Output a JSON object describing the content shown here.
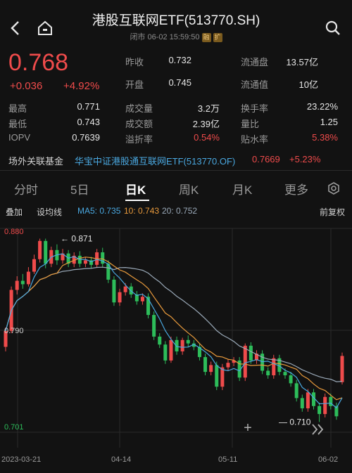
{
  "header": {
    "title": "港股互联网ETF(513770.SH)",
    "status": "闭市 06-02 15:59:50",
    "badge1": "融",
    "badge2": "扩"
  },
  "quote": {
    "price": "0.768",
    "change": "+0.036",
    "change_pct": "+4.92%",
    "rows": [
      [
        {
          "l": "昨收",
          "v": "0.732"
        },
        {
          "l": "流通盘",
          "v": "13.57亿"
        }
      ],
      [
        {
          "l": "开盘",
          "v": "0.745"
        },
        {
          "l": "流通值",
          "v": "10亿"
        }
      ],
      [
        {
          "l": "最高",
          "v": "0.771"
        },
        {
          "l": "成交量",
          "v": "3.2万"
        },
        {
          "l": "换手率",
          "v": "23.22%"
        }
      ],
      [
        {
          "l": "最低",
          "v": "0.743"
        },
        {
          "l": "成交额",
          "v": "2.39亿"
        },
        {
          "l": "量比",
          "v": "1.25"
        }
      ],
      [
        {
          "l": "IOPV",
          "v": "0.7639"
        },
        {
          "l": "溢折率",
          "v": "0.54%"
        },
        {
          "l": "贴水率",
          "v": "5.38%"
        }
      ]
    ]
  },
  "fund": {
    "label": "场外关联基金",
    "name": "华宝中证港股通互联网ETF(513770.OF)",
    "value": "0.7669",
    "change": "+5.23%"
  },
  "tabs": [
    "分时",
    "5日",
    "日K",
    "周K",
    "月K",
    "更多"
  ],
  "active_tab": "日K",
  "indicators": {
    "overlay": "叠加",
    "trend": "设均线",
    "ma5": "MA5: 0.735",
    "ma10": "10: 0.743",
    "ma20": "20: 0.752",
    "adjust": "前复权"
  },
  "colors": {
    "up": "#ef4b4b",
    "down": "#2dbd5a",
    "ma5": "#4aa8e0",
    "ma10": "#e89a3c",
    "ma20": "#9aa9b8"
  },
  "chart_data": {
    "type": "candlestick",
    "y_labels": [
      "0.880",
      "0.790",
      "0.701"
    ],
    "ylim": [
      0.701,
      0.88
    ],
    "x_labels": [
      "2023-03-21",
      "04-14",
      "05-11",
      "06-02"
    ],
    "annotations": {
      "high": "0.871",
      "low": "0.710"
    },
    "candles": [
      [
        0.776,
        0.79,
        0.772,
        0.793
      ],
      [
        0.79,
        0.826,
        0.788,
        0.829
      ],
      [
        0.826,
        0.834,
        0.822,
        0.838
      ],
      [
        0.834,
        0.831,
        0.827,
        0.84
      ],
      [
        0.831,
        0.842,
        0.829,
        0.846
      ],
      [
        0.842,
        0.853,
        0.84,
        0.857
      ],
      [
        0.853,
        0.869,
        0.85,
        0.871
      ],
      [
        0.869,
        0.849,
        0.845,
        0.871
      ],
      [
        0.849,
        0.861,
        0.846,
        0.864
      ],
      [
        0.861,
        0.852,
        0.848,
        0.866
      ],
      [
        0.852,
        0.858,
        0.849,
        0.862
      ],
      [
        0.858,
        0.849,
        0.846,
        0.861
      ],
      [
        0.849,
        0.856,
        0.846,
        0.859
      ],
      [
        0.856,
        0.849,
        0.846,
        0.86
      ],
      [
        0.849,
        0.852,
        0.846,
        0.855
      ],
      [
        0.852,
        0.848,
        0.845,
        0.855
      ],
      [
        0.848,
        0.859,
        0.846,
        0.862
      ],
      [
        0.859,
        0.849,
        0.846,
        0.863
      ],
      [
        0.849,
        0.835,
        0.832,
        0.852
      ],
      [
        0.835,
        0.815,
        0.812,
        0.838
      ],
      [
        0.815,
        0.824,
        0.812,
        0.827
      ],
      [
        0.824,
        0.829,
        0.821,
        0.832
      ],
      [
        0.829,
        0.822,
        0.819,
        0.832
      ],
      [
        0.822,
        0.816,
        0.813,
        0.825
      ],
      [
        0.816,
        0.82,
        0.813,
        0.823
      ],
      [
        0.82,
        0.804,
        0.801,
        0.823
      ],
      [
        0.804,
        0.785,
        0.782,
        0.807
      ],
      [
        0.785,
        0.778,
        0.775,
        0.788
      ],
      [
        0.778,
        0.764,
        0.761,
        0.781
      ],
      [
        0.764,
        0.782,
        0.762,
        0.785
      ],
      [
        0.782,
        0.772,
        0.769,
        0.785
      ],
      [
        0.772,
        0.782,
        0.769,
        0.784
      ],
      [
        0.782,
        0.779,
        0.776,
        0.786
      ],
      [
        0.779,
        0.776,
        0.773,
        0.782
      ],
      [
        0.776,
        0.767,
        0.764,
        0.779
      ],
      [
        0.767,
        0.754,
        0.751,
        0.77
      ],
      [
        0.754,
        0.76,
        0.751,
        0.763
      ],
      [
        0.76,
        0.741,
        0.738,
        0.763
      ],
      [
        0.741,
        0.758,
        0.738,
        0.761
      ],
      [
        0.758,
        0.762,
        0.755,
        0.765
      ],
      [
        0.762,
        0.764,
        0.759,
        0.767
      ],
      [
        0.764,
        0.749,
        0.746,
        0.767
      ],
      [
        0.749,
        0.777,
        0.746,
        0.779
      ],
      [
        0.777,
        0.764,
        0.761,
        0.78
      ],
      [
        0.764,
        0.77,
        0.761,
        0.773
      ],
      [
        0.77,
        0.755,
        0.752,
        0.773
      ],
      [
        0.755,
        0.751,
        0.748,
        0.758
      ],
      [
        0.751,
        0.766,
        0.748,
        0.769
      ],
      [
        0.766,
        0.754,
        0.751,
        0.769
      ],
      [
        0.754,
        0.751,
        0.748,
        0.757
      ],
      [
        0.751,
        0.744,
        0.741,
        0.754
      ],
      [
        0.744,
        0.731,
        0.728,
        0.747
      ],
      [
        0.731,
        0.722,
        0.719,
        0.734
      ],
      [
        0.722,
        0.736,
        0.719,
        0.739
      ],
      [
        0.736,
        0.724,
        0.721,
        0.739
      ],
      [
        0.724,
        0.717,
        0.71,
        0.727
      ],
      [
        0.717,
        0.732,
        0.714,
        0.735
      ],
      [
        0.732,
        0.724,
        0.721,
        0.735
      ],
      [
        0.724,
        0.715,
        0.712,
        0.727
      ],
      [
        0.745,
        0.768,
        0.743,
        0.771
      ]
    ]
  },
  "controls": {
    "zoom_in": "+",
    "zoom_out": "−"
  }
}
